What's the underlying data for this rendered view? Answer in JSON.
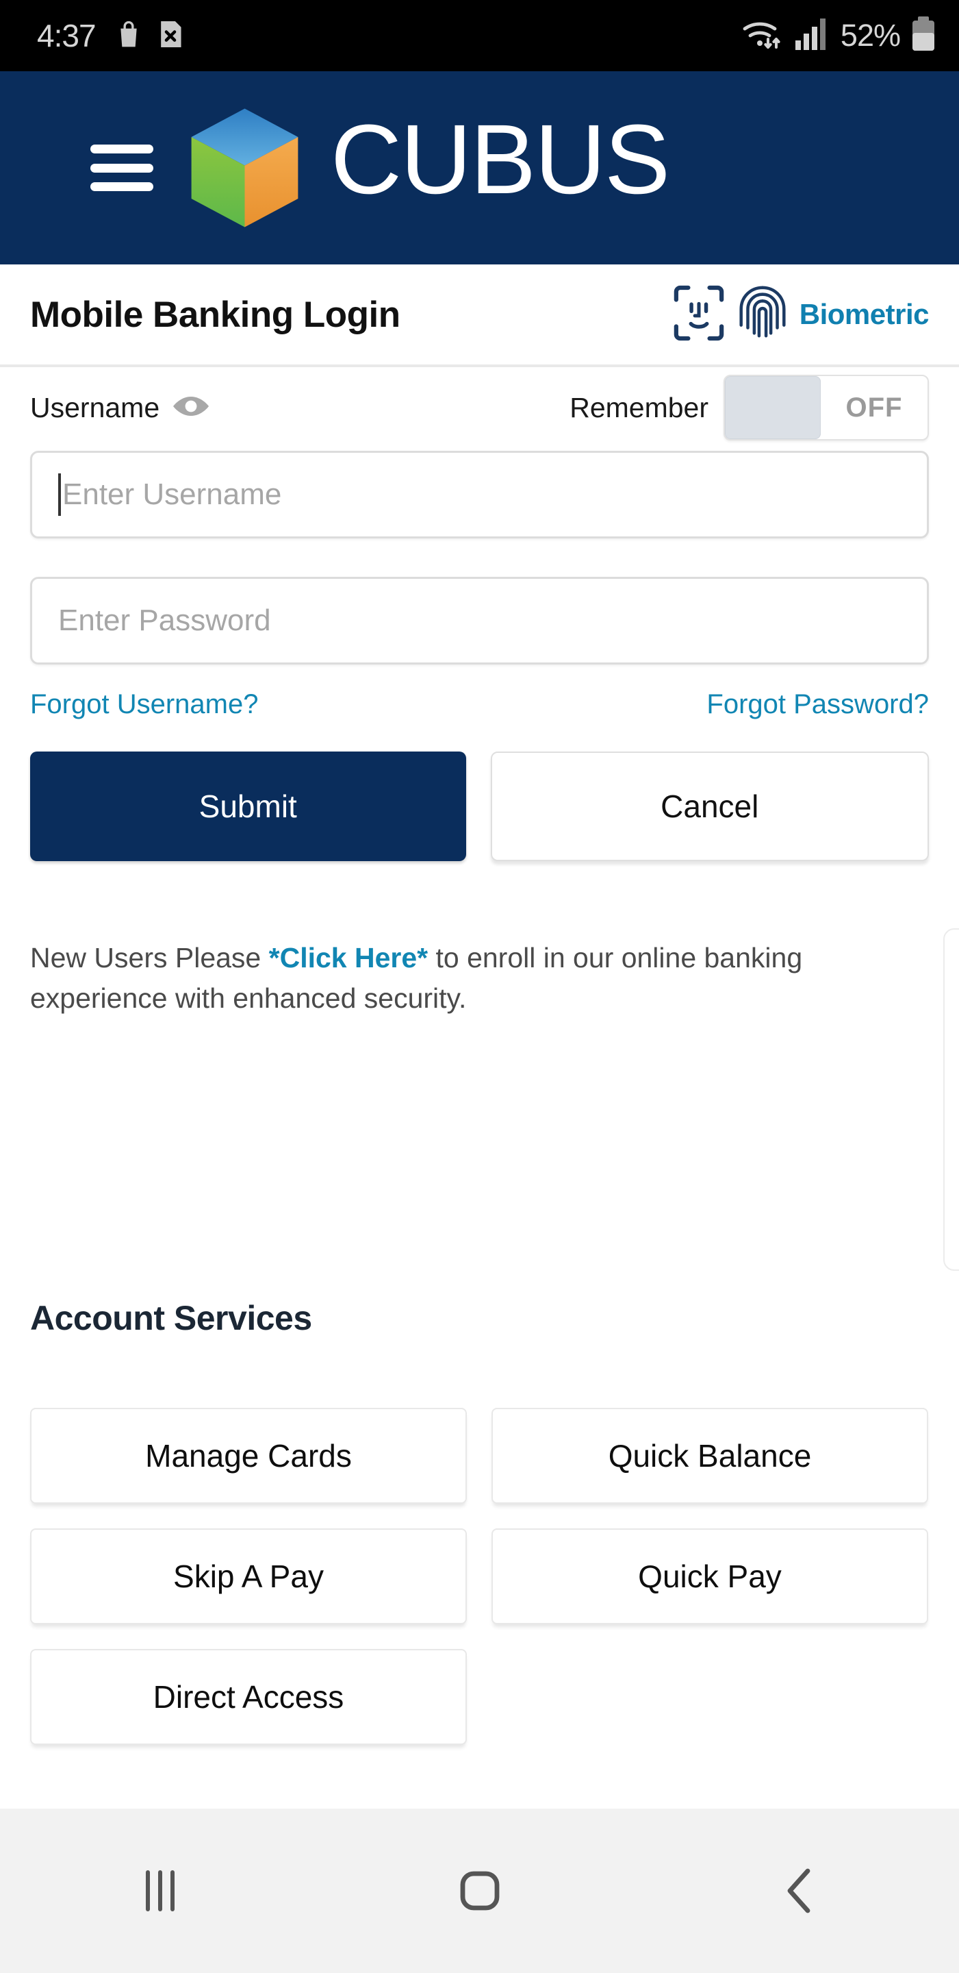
{
  "status_bar": {
    "time": "4:37",
    "left_icons": [
      "shopping-bag-icon",
      "sim-card-error-icon"
    ],
    "right_icons": [
      "wifi-icon",
      "cellular-signal-icon"
    ],
    "battery_percent": "52%",
    "battery_icon": "battery-half-icon"
  },
  "app_header": {
    "menu_icon": "hamburger-menu-icon",
    "logo_icon": "cubus-cube-logo-icon",
    "brand": "CUBUS",
    "background_color": "#0a2d5c",
    "logo_colors": {
      "top": "#3b8fd0",
      "left": "#7cc34a",
      "right": "#f0a040"
    }
  },
  "title_bar": {
    "title": "Mobile Banking Login",
    "biometric_label": "Biometric",
    "biometric_color": "#1080b0",
    "face_icon": "face-id-icon",
    "fingerprint_icon": "fingerprint-icon"
  },
  "login_form": {
    "username_label": "Username",
    "username_visibility_icon": "eye-icon",
    "remember_label": "Remember",
    "remember_state": "OFF",
    "remember_enabled": false,
    "username_value": "",
    "username_placeholder": "Enter Username",
    "password_value": "",
    "password_placeholder": "Enter Password",
    "forgot_username": "Forgot Username?",
    "forgot_password": "Forgot Password?",
    "link_color": "#1186b3",
    "submit_label": "Submit",
    "cancel_label": "Cancel",
    "submit_color": "#0a2d5c"
  },
  "enroll_notice": {
    "prefix": "New Users Please ",
    "link": "*Click Here*",
    "suffix": " to enroll in our online banking experience with enhanced security."
  },
  "account_services": {
    "heading": "Account Services",
    "buttons": [
      {
        "label": "Manage Cards"
      },
      {
        "label": "Quick Balance"
      },
      {
        "label": "Skip A Pay"
      },
      {
        "label": "Quick Pay"
      },
      {
        "label": "Direct Access"
      }
    ]
  },
  "nav_bar": {
    "recents_icon": "recents-icon",
    "home_icon": "home-icon",
    "back_icon": "back-icon"
  }
}
